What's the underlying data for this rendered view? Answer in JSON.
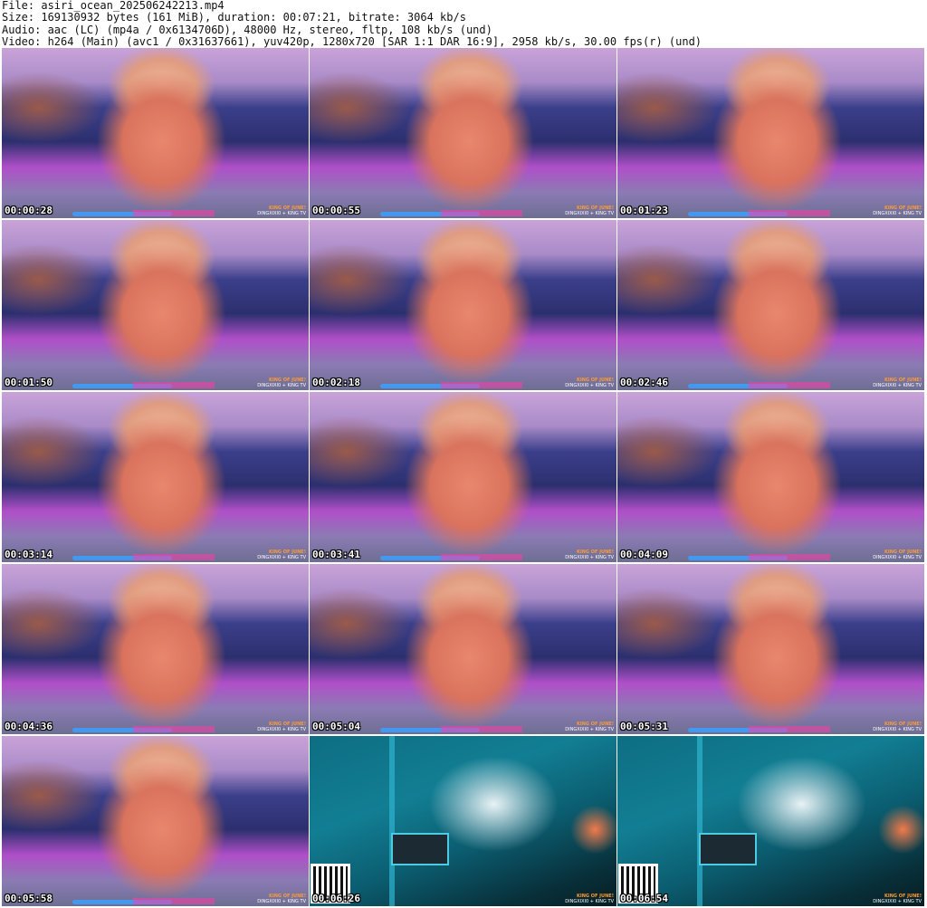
{
  "header": {
    "line1": "File: asiri_ocean_202506242213.mp4",
    "line2": "Size: 169130932 bytes (161 MiB), duration: 00:07:21, bitrate: 3064 kb/s",
    "line3": "Audio: aac (LC) (mp4a / 0x6134706D), 48000 Hz, stereo, fltp, 108 kb/s (und)",
    "line4": "Video: h264 (Main) (avc1 / 0x31637661), yuv420p, 1280x720 [SAR 1:1 DAR 16:9], 2958 kb/s, 30.00 fps(r) (und)"
  },
  "overlay": {
    "king": "KING OF JUNE!",
    "sub": "DINGXIXI0 + KING TV"
  },
  "thumbnails": [
    {
      "time": "00:00:28",
      "scene": "room"
    },
    {
      "time": "00:00:55",
      "scene": "room"
    },
    {
      "time": "00:01:23",
      "scene": "room"
    },
    {
      "time": "00:01:50",
      "scene": "room"
    },
    {
      "time": "00:02:18",
      "scene": "room"
    },
    {
      "time": "00:02:46",
      "scene": "room"
    },
    {
      "time": "00:03:14",
      "scene": "room"
    },
    {
      "time": "00:03:41",
      "scene": "room"
    },
    {
      "time": "00:04:09",
      "scene": "room"
    },
    {
      "time": "00:04:36",
      "scene": "room"
    },
    {
      "time": "00:05:04",
      "scene": "room"
    },
    {
      "time": "00:05:31",
      "scene": "room"
    },
    {
      "time": "00:05:58",
      "scene": "room"
    },
    {
      "time": "00:06:26",
      "scene": "ocean"
    },
    {
      "time": "00:06:54",
      "scene": "ocean"
    }
  ]
}
